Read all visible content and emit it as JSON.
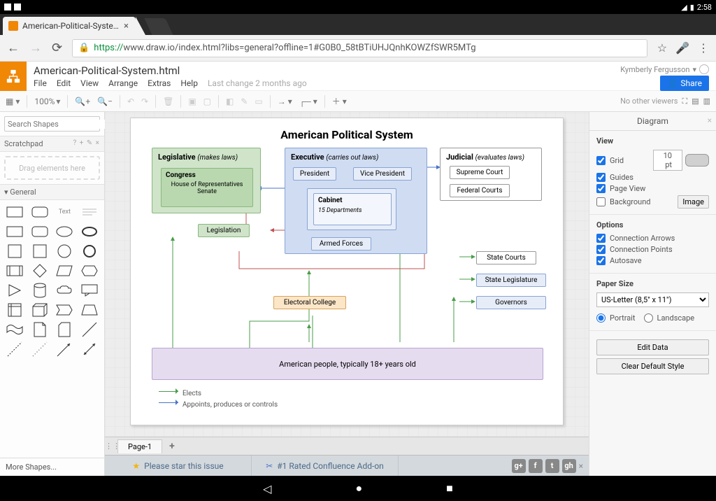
{
  "statusbar": {
    "time": "2:58"
  },
  "browser": {
    "tab_title": "American-Political-System.h",
    "url_protocol": "https://",
    "url_host": "www.draw.io",
    "url_path": "/index.html?libs=general?offline=1#G0B0_58tBTiUHJQnhKOWZfSWR5MTg"
  },
  "app": {
    "doc_title": "American-Political-System.html",
    "menus": {
      "file": "File",
      "edit": "Edit",
      "view": "View",
      "arrange": "Arrange",
      "extras": "Extras",
      "help": "Help"
    },
    "last_change": "Last change 2 months ago",
    "user": "Kymberly Fergusson",
    "share": "Share",
    "zoom": "100%",
    "no_viewers": "No other viewers"
  },
  "left": {
    "search_placeholder": "Search Shapes",
    "scratchpad": "Scratchpad",
    "dropzone": "Drag elements here",
    "general": "General",
    "text_cell": "Text",
    "more": "More Shapes..."
  },
  "right": {
    "title": "Diagram",
    "view": "View",
    "grid": "Grid",
    "grid_pt": "10 pt",
    "guides": "Guides",
    "page_view": "Page View",
    "background": "Background",
    "image_btn": "Image",
    "options": "Options",
    "conn_arrows": "Connection Arrows",
    "conn_points": "Connection Points",
    "autosave": "Autosave",
    "paper_size": "Paper Size",
    "paper_value": "US-Letter (8,5\" x 11\")",
    "portrait": "Portrait",
    "landscape": "Landscape",
    "edit_data": "Edit Data",
    "clear_style": "Clear Default Style"
  },
  "footer": {
    "page_tab": "Page-1",
    "star_issue": "Please star this issue",
    "confluence": "#1 Rated Confluence Add-on"
  },
  "diagram": {
    "title": "American Political System",
    "legislative": {
      "title": "Legislative",
      "sub": "(makes laws)",
      "congress": "Congress",
      "congress_sub": "House of Representatives\nSenate"
    },
    "executive": {
      "title": "Executive",
      "sub": "(carries out laws)",
      "president": "President",
      "vp": "Vice President",
      "cabinet": "Cabinet",
      "cabinet_sub": "15 Departments",
      "armed": "Armed Forces"
    },
    "judicial": {
      "title": "Judicial",
      "sub": "(evaluates laws)",
      "supreme": "Supreme Court",
      "federal": "Federal Courts"
    },
    "legislation": "Legislation",
    "electoral": "Electoral College",
    "people": "American people, typically 18+ years old",
    "state_courts": "State Courts",
    "state_leg": "State Legislature",
    "governors": "Governors",
    "legend_elects": "Elects",
    "legend_appoints": "Appoints, produces or controls"
  }
}
